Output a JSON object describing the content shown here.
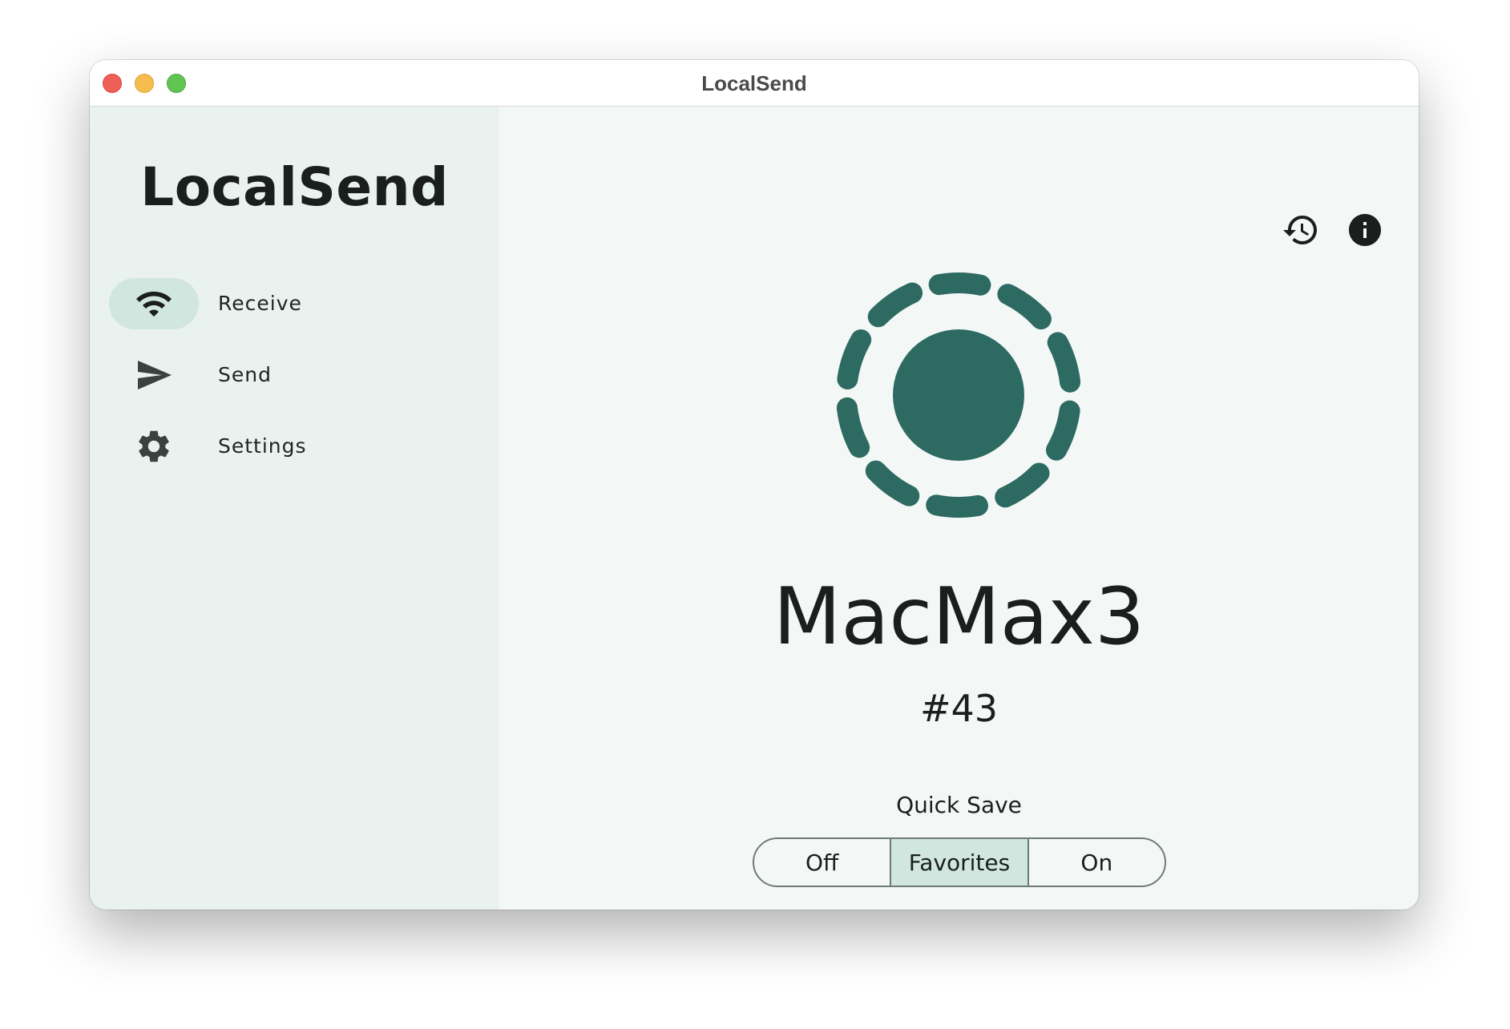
{
  "window": {
    "title": "LocalSend",
    "traffic_lights": {
      "close_color": "#ee5f57",
      "minimize_color": "#f5bd4f",
      "maximize_color": "#61c554"
    }
  },
  "sidebar": {
    "app_title": "LocalSend",
    "items": [
      {
        "label": "Receive",
        "icon": "wifi-icon",
        "active": true
      },
      {
        "label": "Send",
        "icon": "send-icon",
        "active": false
      },
      {
        "label": "Settings",
        "icon": "gear-icon",
        "active": false
      }
    ]
  },
  "main": {
    "top_actions": [
      {
        "icon": "history-icon"
      },
      {
        "icon": "info-icon"
      }
    ],
    "device_name": "MacMax3",
    "device_id": "#43",
    "quick_save": {
      "label": "Quick Save",
      "options": [
        "Off",
        "Favorites",
        "On"
      ],
      "selected": "Favorites"
    }
  },
  "colors": {
    "accent": "#2d6a62",
    "sidebar_bg": "#e9f2ef",
    "main_bg": "#f3f8f6",
    "selected_bg": "#d0e6df"
  }
}
